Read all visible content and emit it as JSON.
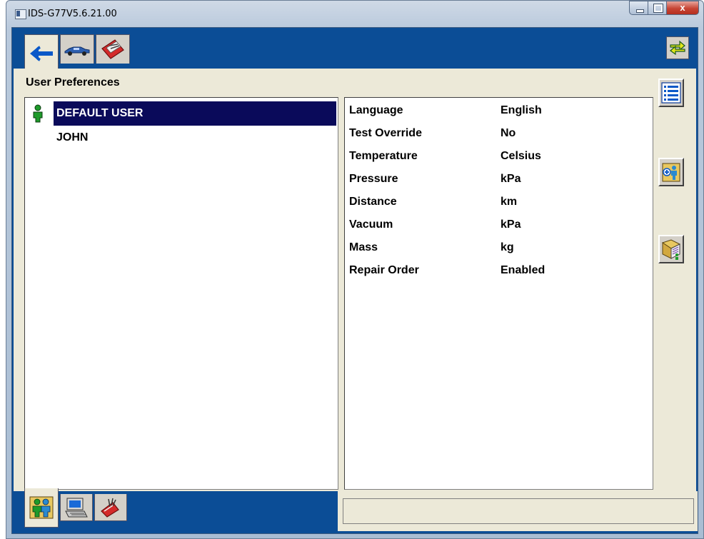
{
  "window": {
    "title": "IDS-G77V5.6.21.00",
    "close_glyph": "x"
  },
  "top_tabs": [
    {
      "icon": "connector-arrow-icon",
      "active": true
    },
    {
      "icon": "vehicle-icon",
      "active": false
    },
    {
      "icon": "toolbox-icon",
      "active": false
    }
  ],
  "section": {
    "title": "User Preferences"
  },
  "users": [
    {
      "name": "DEFAULT USER",
      "selected": true,
      "icon": "person-icon"
    },
    {
      "name": "JOHN",
      "selected": false
    }
  ],
  "preferences": [
    {
      "key": "Language",
      "value": "English"
    },
    {
      "key": "Test Override",
      "value": "No"
    },
    {
      "key": "Temperature",
      "value": "Celsius"
    },
    {
      "key": "Pressure",
      "value": "kPa"
    },
    {
      "key": "Distance",
      "value": "km"
    },
    {
      "key": "Vacuum",
      "value": "kPa"
    },
    {
      "key": "Mass",
      "value": "kg"
    },
    {
      "key": "Repair Order",
      "value": "Enabled"
    }
  ],
  "side_buttons": [
    {
      "icon": "list-icon"
    },
    {
      "icon": "add-user-icon"
    },
    {
      "icon": "edit-user-icon"
    }
  ],
  "bottom_tabs": [
    {
      "icon": "users-icon",
      "active": true
    },
    {
      "icon": "computer-icon",
      "active": false
    },
    {
      "icon": "tools-icon",
      "active": false
    }
  ],
  "colors": {
    "client_bg": "#0b4d96",
    "panel_bg": "#ece9d8",
    "selection_bg": "#0a0a5a",
    "accent_green": "#1e9a2a"
  }
}
